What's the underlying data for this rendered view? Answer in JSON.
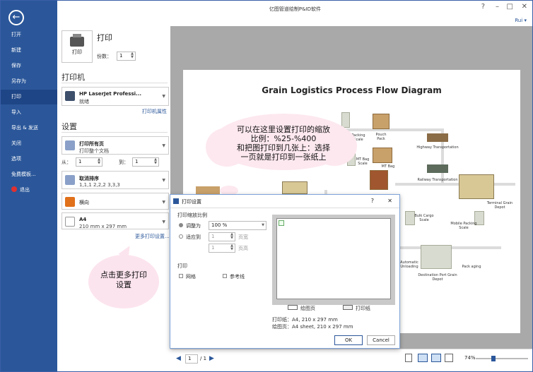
{
  "window": {
    "title": "亿图管道绘制P&ID软件",
    "user": "Rui",
    "controls": [
      "?",
      "–",
      "□",
      "✕"
    ]
  },
  "sidebar": {
    "items": [
      {
        "label": "打开"
      },
      {
        "label": "新建"
      },
      {
        "label": "保存"
      },
      {
        "label": "另存为"
      },
      {
        "label": "打印",
        "active": true
      },
      {
        "label": "导入"
      },
      {
        "label": "导出 & 发送"
      },
      {
        "label": "关闭"
      },
      {
        "label": "选项"
      },
      {
        "label": "免费模板..."
      },
      {
        "label": "退出"
      }
    ]
  },
  "print_panel": {
    "title": "打印",
    "print_button": "打印",
    "copies_label": "份数：",
    "copies_value": "1",
    "printer_heading": "打印机",
    "printer_name": "HP LaserJet Professi...",
    "printer_status": "就绪",
    "printer_props_link": "打印机属性",
    "settings_heading": "设置",
    "print_range_t1": "打印所有页",
    "print_range_t2": "打印整个文档",
    "from_label": "从：",
    "from_value": "1",
    "to_label": "到：",
    "to_value": "1",
    "collate_t1": "取消排序",
    "collate_t2": "1,1,1   2,2,2   3,3,3",
    "orientation": "横向",
    "paper_t1": "A4",
    "paper_t2": "210 mm x 297 mm",
    "more_settings_link": "更多打印设置..."
  },
  "preview": {
    "page_title": "Grain Logistics Process Flow Diagram",
    "labels": {
      "packing_scale": "Packing Scale",
      "pouch_pack": "Pouch Pack",
      "mt_bag_scale": "MT Bag Scale",
      "mt_bag": "MT Bag",
      "highway": "Highway Transportation",
      "railway": "Railway Transportation",
      "terminal": "Terminal Grain Depot",
      "bulk_cargo": "Bulk Cargo Scale",
      "mobile_packing": "Mobile Packing Scale",
      "auto_unload": "Automatic Unloading",
      "dest_port": "Destination Port Grain Depot",
      "packaging": "Pack aging"
    }
  },
  "bottombar": {
    "page_current": "1",
    "page_total": "/ 1",
    "zoom": "74%"
  },
  "callouts": {
    "top": [
      "可以在这里设置打印的缩放",
      "比例：%25-%400",
      "和把图打印到几张上：选择",
      "一页就是打印到一张纸上"
    ],
    "bottom": [
      "点击更多打印",
      "设置"
    ]
  },
  "dialog": {
    "title": "打印设置",
    "help": "?",
    "close": "✕",
    "scale_group": "打印缩放比例",
    "adjust_label": "调整为",
    "adjust_value": "100 %",
    "fit_label": "适应到",
    "fit_value1": "1",
    "fit_unit1": "页宽",
    "fit_value2": "1",
    "fit_unit2": "页高",
    "print_group": "打印",
    "grid_label": "网格",
    "guides_label": "参考线",
    "legend_drawing": "绘图页",
    "legend_paper": "打印纸",
    "paper_info": "打印纸：A4, 210 x 297 mm",
    "drawing_info": "绘图页：A4 sheet, 210 x 297 mm",
    "ok": "OK",
    "cancel": "Cancel"
  }
}
